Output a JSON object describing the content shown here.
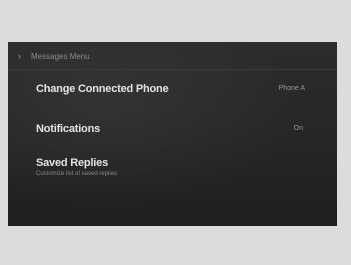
{
  "menu": {
    "header": "Messages Menu",
    "items": [
      {
        "label": "Change Connected Phone",
        "value": "Phone A"
      },
      {
        "label": "Notifications",
        "value": "On"
      },
      {
        "label": "Saved Replies",
        "sub": "Customize list of saved replies"
      }
    ]
  },
  "colors": {
    "frame": "#dcdcdc",
    "screen_bg": "#262626",
    "label": "#e4e4e4",
    "secondary": "#8a8a8a"
  }
}
